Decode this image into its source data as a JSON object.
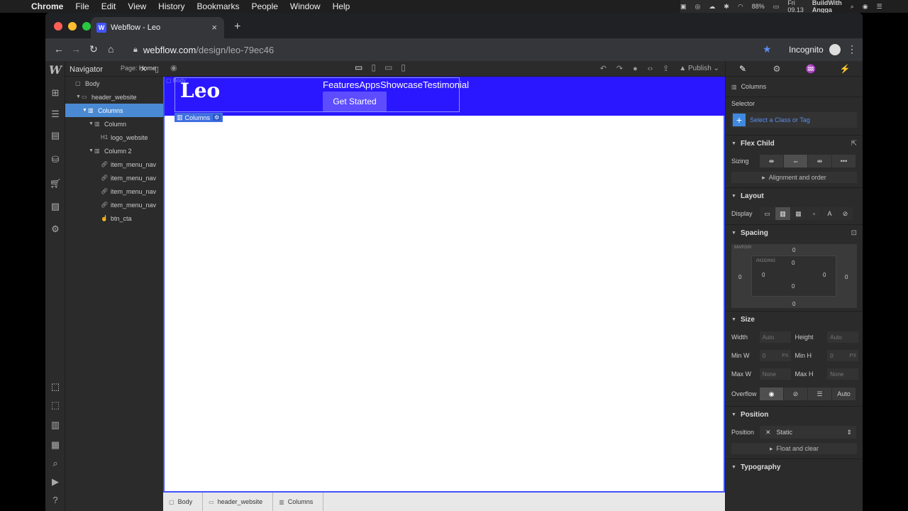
{
  "menubar": {
    "app": "Chrome",
    "items": [
      "File",
      "Edit",
      "View",
      "History",
      "Bookmarks",
      "People",
      "Window",
      "Help"
    ],
    "battery": "88%",
    "clock": "Fri 09.13",
    "user": "BuildWith Angga"
  },
  "browser": {
    "tab_title": "Webflow - Leo",
    "url_host": "webflow.com",
    "url_path": "/design/leo-79ec46",
    "profile": "Incognito"
  },
  "designer": {
    "page_label": "Page:",
    "page_name": "Home",
    "publish": "Publish",
    "navigator": {
      "title": "Navigator",
      "tree": [
        {
          "label": "Body",
          "indent": 0,
          "icon": "box"
        },
        {
          "label": "header_website",
          "indent": 1,
          "icon": "section"
        },
        {
          "label": "Columns",
          "indent": 2,
          "icon": "columns",
          "selected": true
        },
        {
          "label": "Column",
          "indent": 3,
          "icon": "column"
        },
        {
          "label": "logo_website",
          "indent": 4,
          "icon": "h1"
        },
        {
          "label": "Column 2",
          "indent": 3,
          "icon": "column"
        },
        {
          "label": "item_menu_nav",
          "indent": 4,
          "icon": "link"
        },
        {
          "label": "item_menu_nav",
          "indent": 4,
          "icon": "link"
        },
        {
          "label": "item_menu_nav",
          "indent": 4,
          "icon": "link"
        },
        {
          "label": "item_menu_nav",
          "indent": 4,
          "icon": "link"
        },
        {
          "label": "btn_cta",
          "indent": 4,
          "icon": "hand"
        }
      ]
    },
    "canvas": {
      "body_tag": "Body",
      "logo": "Leo",
      "menu": [
        "Features",
        "Apps",
        "Showcase",
        "Testimonial"
      ],
      "cta": "Get Started",
      "selected_label": "Columns"
    },
    "breadcrumbs": [
      "Body",
      "header_website",
      "Columns"
    ],
    "style_panel": {
      "element": "Columns",
      "selector_label": "Selector",
      "selector_placeholder": "Select a Class or Tag",
      "flex_child": "Flex Child",
      "sizing": "Sizing",
      "alignment": "Alignment and order",
      "layout": "Layout",
      "display": "Display",
      "spacing": "Spacing",
      "margin_cap": "MARGIN",
      "padding_cap": "PADDING",
      "margin": {
        "top": "0",
        "right": "0",
        "bottom": "0",
        "left": "0"
      },
      "padding": {
        "top": "0",
        "right": "0",
        "bottom": "0",
        "left": "0"
      },
      "size": "Size",
      "width_lbl": "Width",
      "height_lbl": "Height",
      "minw_lbl": "Min W",
      "minh_lbl": "Min H",
      "maxw_lbl": "Max W",
      "maxh_lbl": "Max H",
      "auto": "Auto",
      "none": "None",
      "zero": "0",
      "px": "PX",
      "overflow": "Overflow",
      "overflow_auto": "Auto",
      "position": "Position",
      "position_lbl": "Position",
      "position_value": "Static",
      "float": "Float and clear",
      "typography": "Typography"
    }
  }
}
